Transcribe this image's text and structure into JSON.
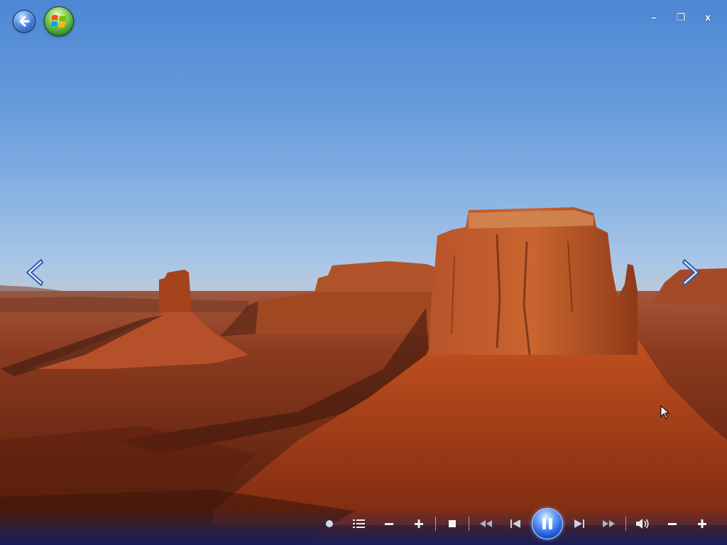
{
  "window": {
    "minimize_label": "–",
    "restore_label": "❐",
    "close_label": "x"
  },
  "nav": {
    "prev_icon": "chevron-left-icon",
    "next_icon": "chevron-right-icon"
  },
  "transport": {
    "buttons": [
      "shuffle-dot",
      "playlist",
      "zoom-out",
      "zoom-in",
      "stop",
      "rewind",
      "previous",
      "pause",
      "next",
      "fast-forward",
      "volume",
      "volume-down",
      "volume-up"
    ],
    "state": "playing"
  },
  "colors": {
    "sky_top": "#4d87d4",
    "rock": "#b4451e",
    "transport_bar": "#0a1e78",
    "accent_orb": "#1a56d6"
  }
}
